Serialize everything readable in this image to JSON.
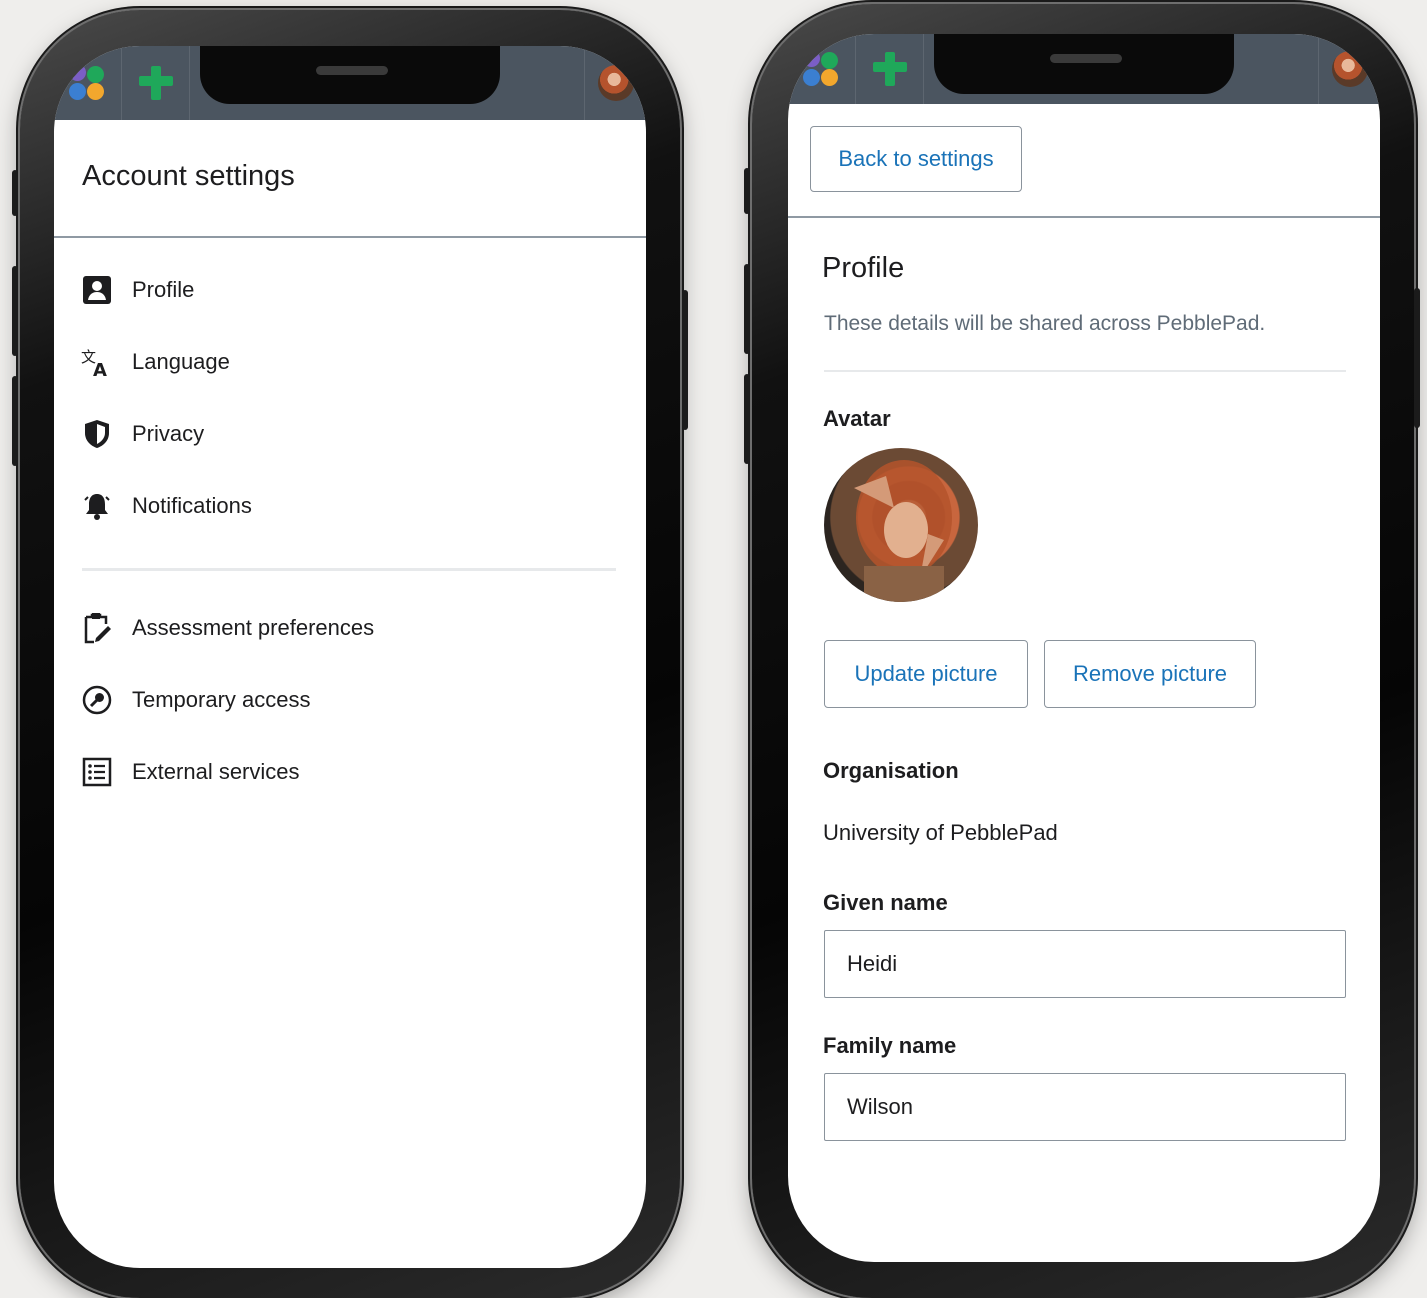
{
  "colors": {
    "topbar": "#4b5560",
    "link": "#1a73b8",
    "divider": "#8f99a3",
    "logo_green": "#1fa85a",
    "logo_blue": "#3b7fd1",
    "logo_yellow": "#f2a72d",
    "logo_purple": "#7b5ec6"
  },
  "topbar": {
    "logo_icon": "pebblepad-logo-icon",
    "add_icon": "green-plus-icon",
    "avatar_icon": "user-avatar-icon"
  },
  "account_settings": {
    "title": "Account settings",
    "items": [
      {
        "label": "Profile",
        "icon": "profile-icon"
      },
      {
        "label": "Language",
        "icon": "translate-icon"
      },
      {
        "label": "Privacy",
        "icon": "shield-icon"
      },
      {
        "label": "Notifications",
        "icon": "bell-icon"
      }
    ],
    "items_secondary": [
      {
        "label": "Assessment preferences",
        "icon": "clipboard-edit-icon"
      },
      {
        "label": "Temporary access",
        "icon": "key-circle-icon"
      },
      {
        "label": "External services",
        "icon": "list-icon"
      }
    ]
  },
  "profile": {
    "back_label": "Back to settings",
    "title": "Profile",
    "description": "These details will be shared across PebblePad.",
    "avatar_label": "Avatar",
    "update_picture": "Update picture",
    "remove_picture": "Remove picture",
    "organisation_label": "Organisation",
    "organisation_value": "University of PebblePad",
    "given_name_label": "Given name",
    "given_name_value": "Heidi",
    "family_name_label": "Family name",
    "family_name_value": "Wilson"
  }
}
